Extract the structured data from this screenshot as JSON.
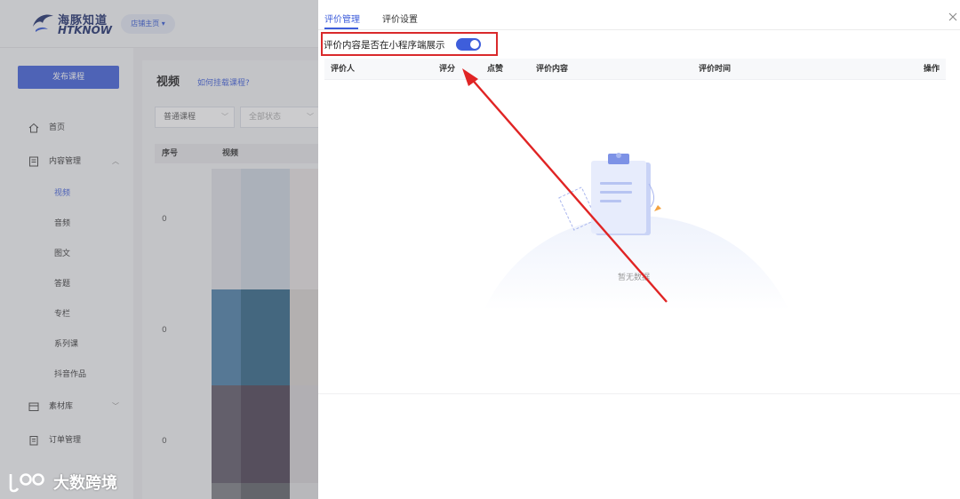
{
  "header": {
    "logo_cn": "海豚知道",
    "logo_en": "HTKNOW",
    "store_button": "店铺主页 ▾"
  },
  "sidebar": {
    "publish_button": "发布课程",
    "items": [
      {
        "label": "首页",
        "icon": "home-icon"
      },
      {
        "label": "内容管理",
        "icon": "content-icon",
        "expanded": true
      },
      {
        "label": "素材库",
        "icon": "library-icon"
      },
      {
        "label": "订单管理",
        "icon": "order-icon"
      }
    ],
    "sub_items": [
      "视频",
      "音频",
      "图文",
      "答题",
      "专栏",
      "系列课",
      "抖音作品"
    ],
    "active_sub": "视频"
  },
  "content": {
    "title": "视频",
    "help_link": "如何挂载课程?",
    "filters": [
      "普通课程",
      "全部状态"
    ],
    "columns": [
      "序号",
      "视频"
    ],
    "row_indexes": [
      "0",
      "0",
      "0"
    ]
  },
  "drawer": {
    "tabs": [
      {
        "label": "评价管理",
        "active": true
      },
      {
        "label": "评价设置",
        "active": false
      }
    ],
    "toggle": {
      "label": "评价内容是否在小程序端展示",
      "on": true
    },
    "columns": [
      "评价人",
      "评分",
      "点赞",
      "评价内容",
      "评价时间",
      "操作"
    ],
    "empty_text": "暂无数据"
  },
  "watermark": {
    "text": "大数跨境"
  },
  "colors": {
    "accent": "#3e5edb",
    "highlight_box": "#d9292b",
    "annotation_arrow": "#e02424"
  }
}
